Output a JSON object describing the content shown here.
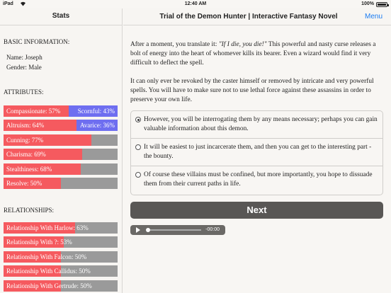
{
  "statusbar": {
    "carrier": "iPad",
    "time": "12:40 AM",
    "battery": "100%"
  },
  "sidebar": {
    "title": "Stats",
    "basic_title": "BASIC INFORMATION:",
    "name": "Name: Joseph",
    "gender": "Gender: Male",
    "attributes_title": "ATTRIBUTES:",
    "attributes": [
      {
        "left_label": "Compassionate: 57%",
        "right_label": "Scornful: 43%",
        "value": 0.57,
        "opposed": true
      },
      {
        "left_label": "Altruism: 64%",
        "right_label": "Avarice: 36%",
        "value": 0.64,
        "opposed": true
      },
      {
        "left_label": "Cunning: 77%",
        "value": 0.77
      },
      {
        "left_label": "Charisma: 69%",
        "value": 0.69
      },
      {
        "left_label": "Stealthiness: 68%",
        "value": 0.68
      },
      {
        "left_label": "Resolve: 50%",
        "value": 0.5
      }
    ],
    "relationships_title": "RELATIONSHIPS:",
    "relationships": [
      {
        "label": "Relationship With Harlow: 63%",
        "value": 0.63
      },
      {
        "label": "Relationship With ?: 53%",
        "value": 0.53
      },
      {
        "label": "Relationship With Falcon: 50%",
        "value": 0.5
      },
      {
        "label": "Relationship With Callidus: 50%",
        "value": 0.5
      },
      {
        "label": "Relationship With Gertrude: 50%",
        "value": 0.5
      }
    ]
  },
  "header": {
    "title": "Trial of the Demon Hunter | Interactive Fantasy Novel",
    "menu": "Menu"
  },
  "story": {
    "p1_before": "After a moment, you translate it: ",
    "p1_quote": "\"If I die, you die!\"",
    "p1_after": " This powerful and nasty curse releases a bolt of energy into the heart of whomever kills its bearer. Even a wizard would find it very difficult to deflect the spell.",
    "p2": "It can only ever be revoked by the caster himself or removed by intricate and very powerful spells. You will have to make sure not to use lethal force against these assassins in order to preserve your own life."
  },
  "choices": [
    {
      "text": "However, you will be interrogating them by any means necessary; perhaps you can gain valuable information about this demon.",
      "selected": true
    },
    {
      "text": "It will be easiest to just incarcerate them, and then you can get to the interesting part - the bounty.",
      "selected": false
    },
    {
      "text": "Of course these villains must be confined, but more importantly, you hope to dissuade them from their current paths in life.",
      "selected": false
    }
  ],
  "next_label": "Next",
  "player": {
    "remaining": "-00:00",
    "progress": 0
  },
  "colors": {
    "positive": "#f55a5f",
    "opposed": "#6e6ef0",
    "track": "#9a9a9a",
    "link": "#1b7cf2"
  }
}
